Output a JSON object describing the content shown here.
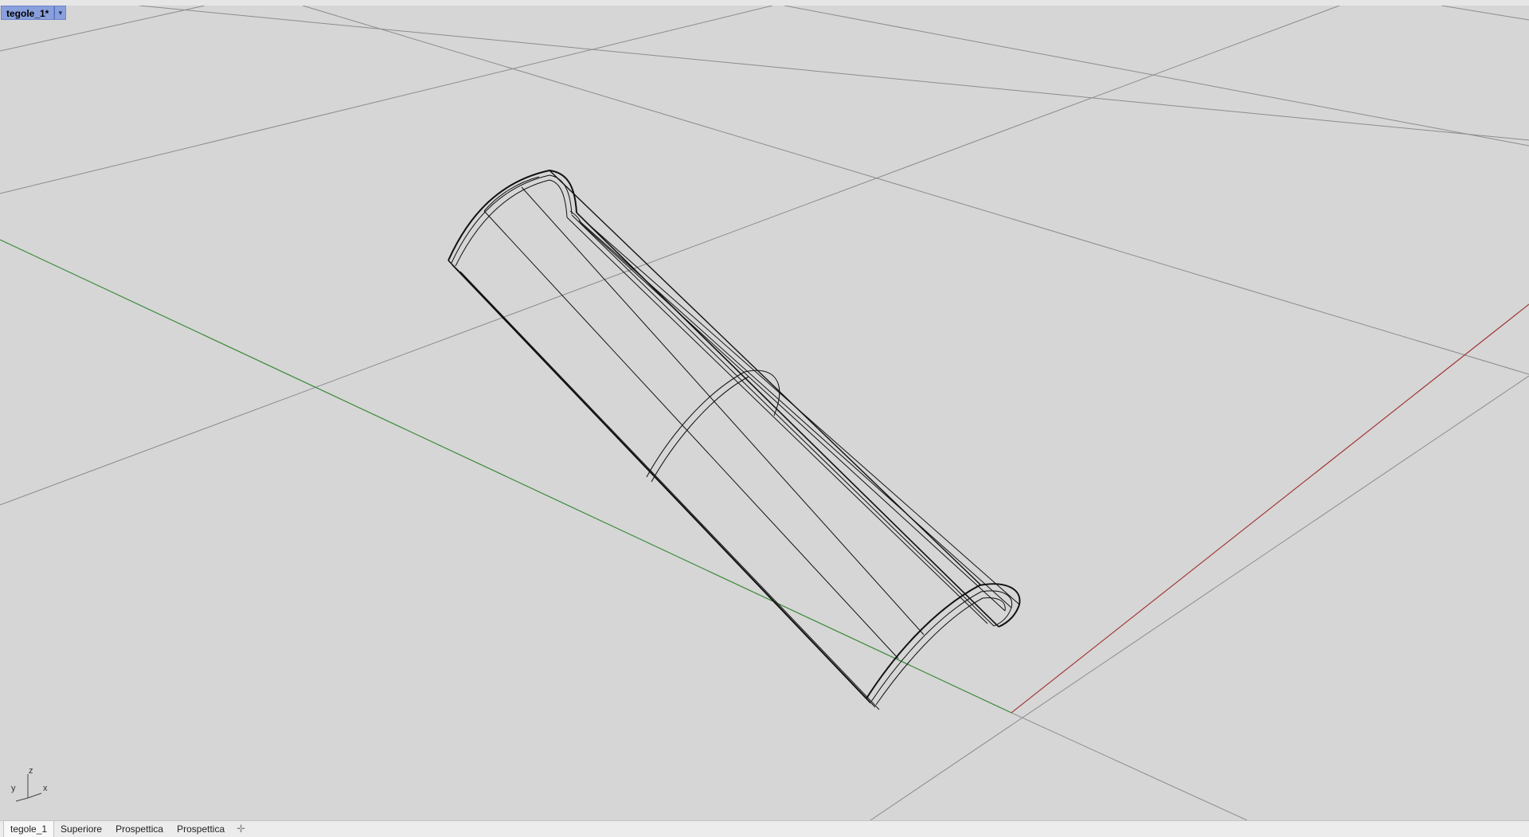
{
  "viewport": {
    "title": "tegole_1*",
    "dropdown_glyph": "▾",
    "dropdown_icon": "chevron-down-icon"
  },
  "axis_gizmo": {
    "z_label": "z",
    "y_label": "y",
    "x_label": "x"
  },
  "tabs": [
    {
      "label": "tegole_1",
      "active": true
    },
    {
      "label": "Superiore",
      "active": false
    },
    {
      "label": "Prospettica",
      "active": false
    },
    {
      "label": "Prospettica",
      "active": false
    }
  ],
  "add_tab_glyph": "✛",
  "colors": {
    "viewport_bg": "#d6d6d6",
    "grid": "#8c8c8c",
    "x_axis": "#a43a3a",
    "y_axis": "#3a8a3a",
    "wireframe": "#111111",
    "title_bg": "#8aa0dc"
  }
}
